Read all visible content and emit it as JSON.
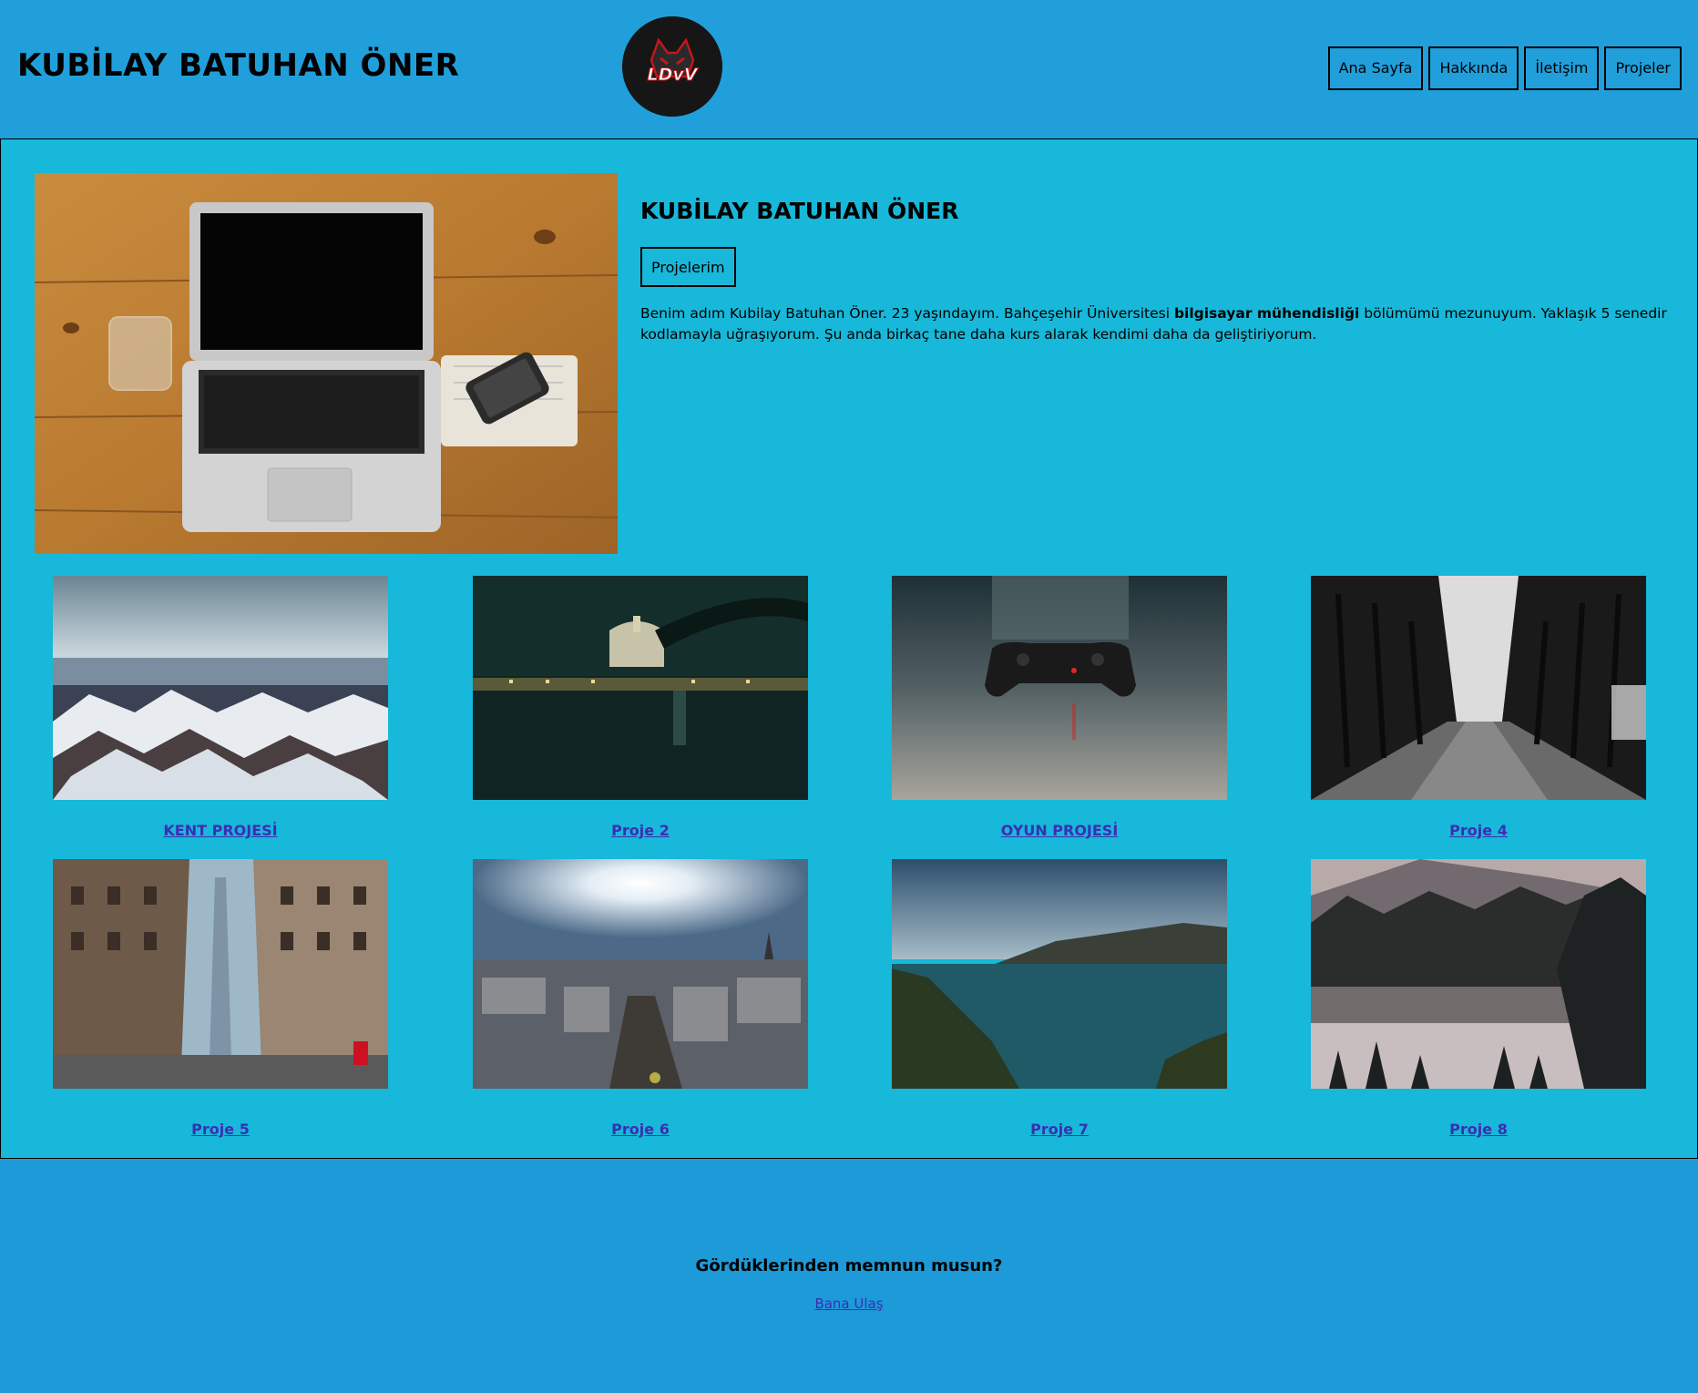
{
  "header": {
    "site_title": "KUBİLAY BATUHAN ÖNER",
    "logo_text": "LDvV",
    "nav": [
      "Ana Sayfa",
      "Hakkında",
      "İletişim",
      "Projeler"
    ]
  },
  "hero": {
    "title": "KUBİLAY BATUHAN ÖNER",
    "button": "Projelerim",
    "text_before": "Benim adım Kubilay Batuhan Öner. 23 yaşındayım. Bahçeşehir Üniversitesi ",
    "text_bold": "bilgisayar mühendisliği",
    "text_after": " bölümümü mezunuyum. Yaklaşık 5 senedir kodlamayla uğraşıyorum. Şu anda birkaç tane daha kurs alarak kendimi daha da geliştiriyorum."
  },
  "projects": [
    {
      "label": "KENT PROJESİ",
      "image": "snowy-city-rooftops"
    },
    {
      "label": "Proje 2",
      "image": "night-london-river"
    },
    {
      "label": "OYUN PROJESİ",
      "image": "game-controller"
    },
    {
      "label": "Proje 4",
      "image": "tree-tunnel-road"
    },
    {
      "label": "Proje 5",
      "image": "new-york-street"
    },
    {
      "label": "Proje 6",
      "image": "paris-skyline"
    },
    {
      "label": "Proje 7",
      "image": "lake-mountains"
    },
    {
      "label": "Proje 8",
      "image": "forest-lake"
    }
  ],
  "footer": {
    "question": "Gördüklerinden memnun musun?",
    "link": "Bana Ulaş"
  },
  "colors": {
    "header_bg": "#219fdb",
    "main_bg": "#17b8d9",
    "page_bg": "#1d9ad8",
    "link": "#3b2fb3"
  }
}
